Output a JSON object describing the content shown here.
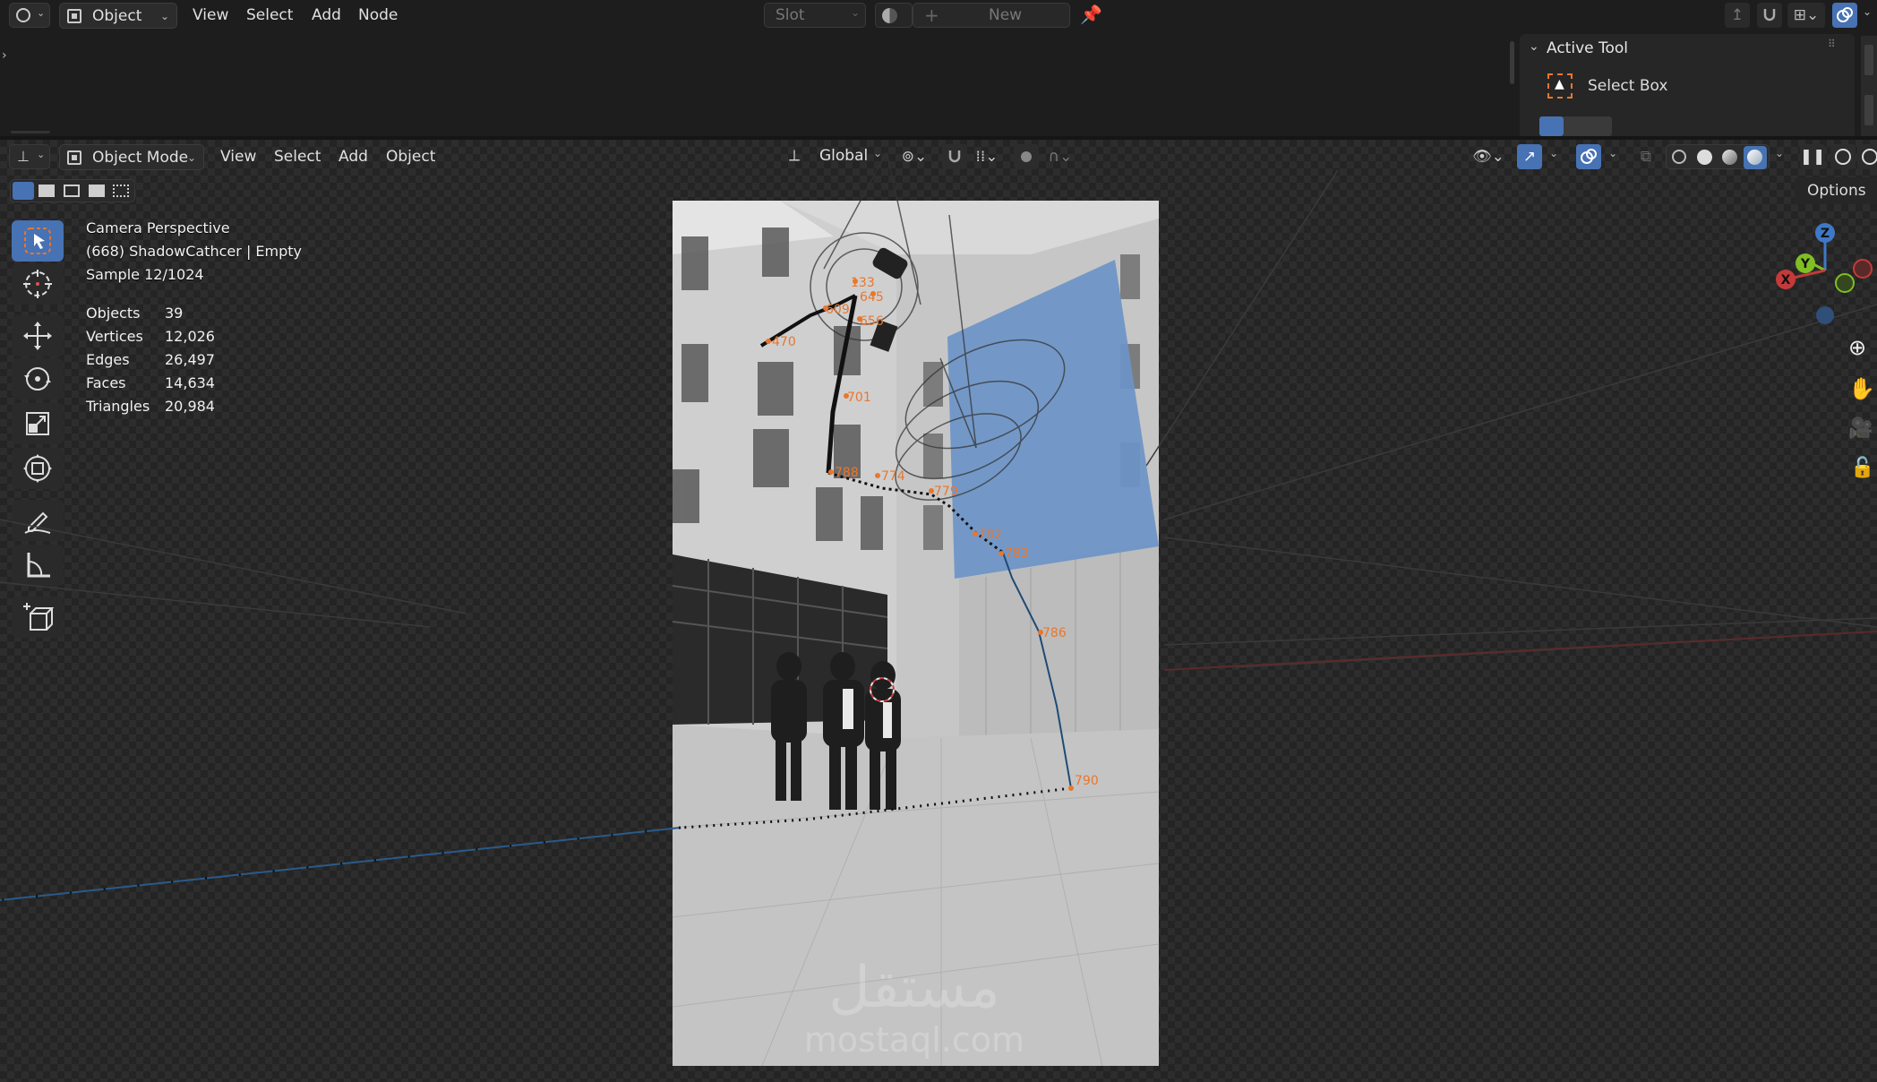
{
  "top_header": {
    "editor_type": "Object",
    "menus": [
      "View",
      "Select",
      "Add",
      "Node"
    ],
    "slot": "Slot",
    "new_label": "New"
  },
  "active_tool_panel": {
    "title": "Active Tool",
    "tool_name": "Select Box"
  },
  "viewport_header": {
    "mode": "Object Mode",
    "menus": [
      "View",
      "Select",
      "Add",
      "Object"
    ],
    "transform_orientation": "Global",
    "options_label": "Options"
  },
  "overlay_info": {
    "view_name": "Camera Perspective",
    "active_object": "(668) ShadowCathcer | Empty",
    "sample": "Sample 12/1024"
  },
  "stats": [
    {
      "label": "Objects",
      "value": "39"
    },
    {
      "label": "Vertices",
      "value": "12,026"
    },
    {
      "label": "Edges",
      "value": "26,497"
    },
    {
      "label": "Faces",
      "value": "14,634"
    },
    {
      "label": "Triangles",
      "value": "20,984"
    }
  ],
  "gizmo": {
    "x": "X",
    "y": "Y",
    "z": "Z"
  },
  "frame_labels": [
    "133",
    "645",
    "609",
    "656",
    "470",
    "701",
    "788",
    "774",
    "779",
    "782",
    "783",
    "786",
    "790"
  ],
  "watermark": {
    "arabic": "مستقل",
    "latin": "mostaql.com"
  },
  "colors": {
    "accent": "#4772b3",
    "frame_label": "#e8772e",
    "x_axis": "#c43a3a",
    "y_axis": "#7fbf24",
    "z_axis": "#3f78c6",
    "plane": "#6b94c7"
  }
}
